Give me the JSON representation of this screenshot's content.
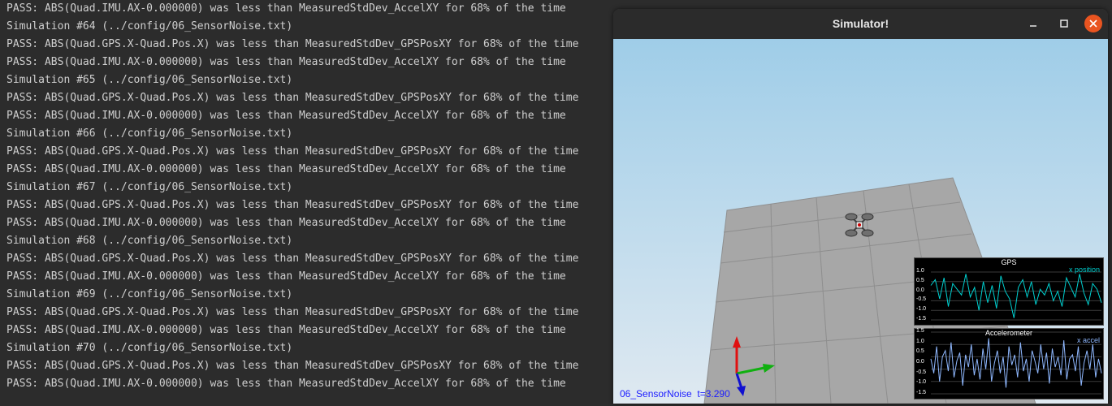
{
  "terminal": {
    "lines": [
      "PASS: ABS(Quad.IMU.AX-0.000000) was less than MeasuredStdDev_AccelXY for 68% of the time",
      "Simulation #64 (../config/06_SensorNoise.txt)",
      "PASS: ABS(Quad.GPS.X-Quad.Pos.X) was less than MeasuredStdDev_GPSPosXY for 68% of the time",
      "PASS: ABS(Quad.IMU.AX-0.000000) was less than MeasuredStdDev_AccelXY for 68% of the time",
      "Simulation #65 (../config/06_SensorNoise.txt)",
      "PASS: ABS(Quad.GPS.X-Quad.Pos.X) was less than MeasuredStdDev_GPSPosXY for 68% of the time",
      "PASS: ABS(Quad.IMU.AX-0.000000) was less than MeasuredStdDev_AccelXY for 68% of the time",
      "Simulation #66 (../config/06_SensorNoise.txt)",
      "PASS: ABS(Quad.GPS.X-Quad.Pos.X) was less than MeasuredStdDev_GPSPosXY for 68% of the time",
      "PASS: ABS(Quad.IMU.AX-0.000000) was less than MeasuredStdDev_AccelXY for 68% of the time",
      "Simulation #67 (../config/06_SensorNoise.txt)",
      "PASS: ABS(Quad.GPS.X-Quad.Pos.X) was less than MeasuredStdDev_GPSPosXY for 68% of the time",
      "PASS: ABS(Quad.IMU.AX-0.000000) was less than MeasuredStdDev_AccelXY for 68% of the time",
      "Simulation #68 (../config/06_SensorNoise.txt)",
      "PASS: ABS(Quad.GPS.X-Quad.Pos.X) was less than MeasuredStdDev_GPSPosXY for 68% of the time",
      "PASS: ABS(Quad.IMU.AX-0.000000) was less than MeasuredStdDev_AccelXY for 68% of the time",
      "Simulation #69 (../config/06_SensorNoise.txt)",
      "PASS: ABS(Quad.GPS.X-Quad.Pos.X) was less than MeasuredStdDev_GPSPosXY for 68% of the time",
      "PASS: ABS(Quad.IMU.AX-0.000000) was less than MeasuredStdDev_AccelXY for 68% of the time",
      "Simulation #70 (../config/06_SensorNoise.txt)",
      "PASS: ABS(Quad.GPS.X-Quad.Pos.X) was less than MeasuredStdDev_GPSPosXY for 68% of the time",
      "PASS: ABS(Quad.IMU.AX-0.000000) was less than MeasuredStdDev_AccelXY for 68% of the time"
    ]
  },
  "window": {
    "title": "Simulator!",
    "icons": {
      "minimize": "minimize-icon",
      "maximize": "maximize-icon",
      "close": "close-icon"
    },
    "close_color": "#e95420"
  },
  "scene": {
    "scenario_label": "06_SensorNoise  t=3.290"
  },
  "plots": {
    "gps": {
      "title": "GPS",
      "series_label": "x position",
      "series_color": "#00d0d0",
      "yticks": [
        "1.0",
        "0.5",
        "0.0",
        "-0.5",
        "-1.0",
        "-1.5"
      ],
      "ylim": [
        -1.5,
        1.0
      ]
    },
    "accel": {
      "title": "Accelerometer",
      "series_label": "x accel",
      "series_color": "#8fb8ff",
      "yticks": [
        "1.5",
        "1.0",
        "0.5",
        "0.0",
        "-0.5",
        "-1.0",
        "-1.5"
      ],
      "ylim": [
        -1.5,
        1.5
      ]
    }
  },
  "chart_data": [
    {
      "type": "line",
      "title": "GPS",
      "series": [
        {
          "name": "x position",
          "values": [
            0.3,
            0.6,
            -0.4,
            0.7,
            -0.8,
            0.4,
            0.1,
            -0.2,
            0.9,
            -0.3,
            0.2,
            -1.0,
            0.5,
            -0.6,
            0.3,
            -0.9,
            0.8,
            0.0,
            -0.4,
            -1.4,
            0.2,
            0.6,
            -0.3,
            0.5,
            -0.7,
            0.1,
            -0.2,
            0.4,
            -0.5,
            0.0,
            -0.8,
            0.7,
            0.2,
            -0.3,
            0.9,
            -0.1,
            -0.7,
            0.4,
            0.1,
            -0.6
          ]
        }
      ],
      "ylim": [
        -1.5,
        1.0
      ]
    },
    {
      "type": "line",
      "title": "Accelerometer",
      "series": [
        {
          "name": "x accel",
          "values": [
            0.2,
            -0.5,
            0.8,
            -0.9,
            0.3,
            0.6,
            -0.4,
            1.0,
            -0.7,
            0.1,
            0.5,
            -1.1,
            0.4,
            -0.2,
            0.9,
            -0.6,
            0.2,
            -0.8,
            0.7,
            -0.3,
            1.2,
            -0.9,
            0.0,
            0.6,
            -0.5,
            0.3,
            -1.2,
            0.8,
            -0.1,
            0.4,
            -0.7,
            1.0,
            -0.4,
            0.2,
            -0.9,
            0.6,
            0.1,
            -0.5,
            0.9,
            -0.3,
            0.5,
            -1.0,
            0.7,
            -0.2,
            0.3,
            -0.6,
            1.1,
            -0.8,
            0.2,
            0.4,
            -0.4,
            0.8,
            -1.1,
            0.0,
            0.6,
            -0.3,
            0.9,
            -0.7,
            0.2,
            -0.5
          ]
        }
      ],
      "ylim": [
        -1.5,
        1.5
      ]
    }
  ]
}
